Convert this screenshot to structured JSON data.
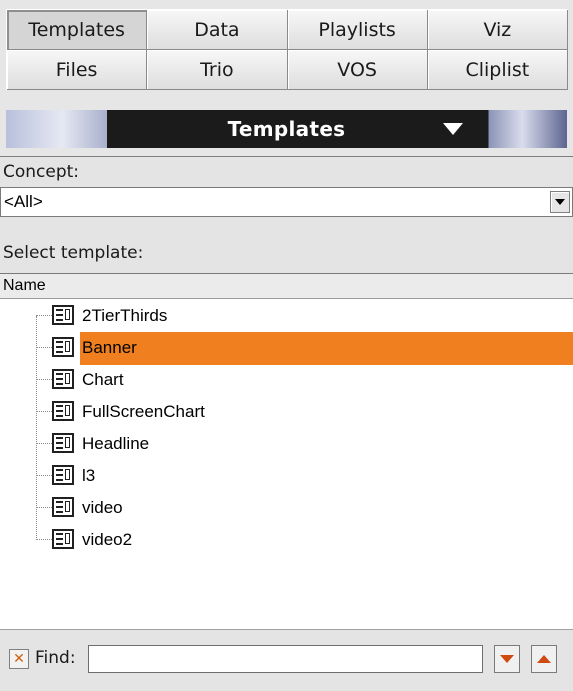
{
  "tabs": [
    {
      "label": "Templates",
      "active": true
    },
    {
      "label": "Data",
      "active": false
    },
    {
      "label": "Playlists",
      "active": false
    },
    {
      "label": "Viz",
      "active": false
    },
    {
      "label": "Files",
      "active": false
    },
    {
      "label": "Trio",
      "active": false
    },
    {
      "label": "VOS",
      "active": false
    },
    {
      "label": "Cliplist",
      "active": false
    }
  ],
  "header": {
    "title": "Templates"
  },
  "concept": {
    "label": "Concept:",
    "value": "<All>"
  },
  "select_template": {
    "label": "Select template:"
  },
  "list": {
    "column_header": "Name",
    "items": [
      {
        "name": "2TierThirds",
        "selected": false
      },
      {
        "name": "Banner",
        "selected": true
      },
      {
        "name": "Chart",
        "selected": false
      },
      {
        "name": "FullScreenChart",
        "selected": false
      },
      {
        "name": "Headline",
        "selected": false
      },
      {
        "name": "l3",
        "selected": false
      },
      {
        "name": "video",
        "selected": false
      },
      {
        "name": "video2",
        "selected": false
      }
    ]
  },
  "find": {
    "label": "Find:",
    "value": "",
    "placeholder": ""
  },
  "colors": {
    "selection": "#f07f1f",
    "header_bg": "#1b1b1b",
    "arrow": "#d04a10"
  }
}
